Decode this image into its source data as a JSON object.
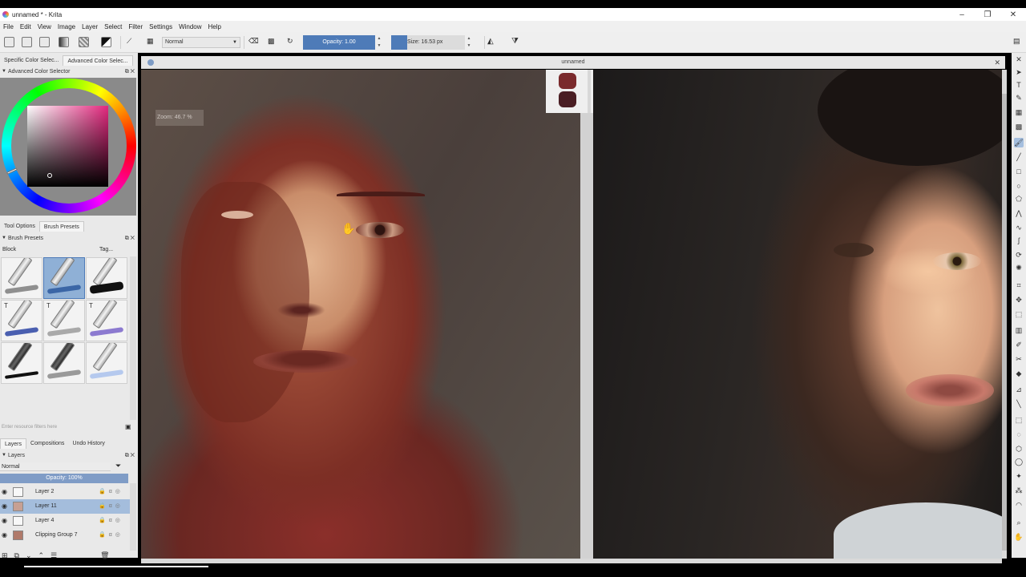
{
  "window": {
    "title": "unnamed * - Krita",
    "controls": [
      "–",
      "❐",
      "✕"
    ]
  },
  "menu": [
    "File",
    "Edit",
    "View",
    "Image",
    "Layer",
    "Select",
    "Filter",
    "Settings",
    "Window",
    "Help"
  ],
  "toolbar": {
    "blend_mode": "Normal",
    "opacity_label": "Opacity: 1.00",
    "size_label": "Size: 16.53 px"
  },
  "left_dock": {
    "color_tabs": [
      "Specific Color Selec...",
      "Advanced Color Selec..."
    ],
    "color_panel_title": "Advanced Color Selector",
    "option_tabs": [
      "Tool Options",
      "Brush Presets"
    ],
    "brush_panel_title": "Brush Presets",
    "brush_filter": "Block",
    "brush_tag_label": "Tag...",
    "resource_filter_placeholder": "Enter resource filters here",
    "layer_tabs": [
      "Layers",
      "Compositions",
      "Undo History"
    ],
    "layers_panel_title": "Layers",
    "layers_blend_mode": "Normal",
    "layers_opacity": "Opacity: 100%",
    "layers": [
      {
        "name": "Layer 2",
        "selected": false
      },
      {
        "name": "Layer 11",
        "selected": true
      },
      {
        "name": "Layer 4",
        "selected": false
      },
      {
        "name": "Clipping Group 7",
        "selected": false
      }
    ]
  },
  "canvas": {
    "document_title": "unnamed",
    "zoom_osd": "Zoom: 46.7 %"
  },
  "colors": {
    "accent": "#4e7bb8",
    "selected_layer": "#a4bddc",
    "selector_hue": "#e3287e"
  },
  "icons": {
    "titlebar": "krita-logo-icon",
    "toolbox": [
      "select-icon",
      "text-icon",
      "pen-icon",
      "grid-icon",
      "pattern-icon",
      "brush-icon",
      "line-icon",
      "rectangle-icon",
      "ellipse-icon",
      "polygon-icon",
      "polyline-icon",
      "bezier-icon",
      "freehand-path-icon",
      "dynamic-brush-icon",
      "multibrush-icon",
      "crop-icon",
      "move-icon",
      "transform-icon",
      "gradient-icon",
      "picker-icon",
      "assistant-icon",
      "fill-icon",
      "measure-icon",
      "rect-select-icon",
      "ellipse-select-icon",
      "poly-select-icon",
      "lasso-icon",
      "contiguous-select-icon",
      "similar-select-icon",
      "bezier-select-icon",
      "zoom-icon",
      "pan-icon"
    ]
  }
}
